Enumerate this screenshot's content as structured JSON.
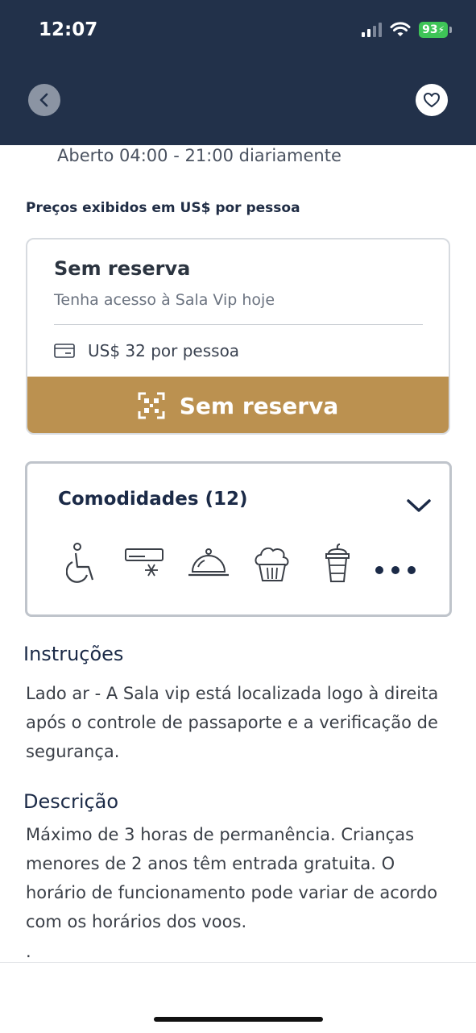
{
  "status_bar": {
    "time": "12:07",
    "battery": "93"
  },
  "header": {
    "back_icon": "chevron-left-icon",
    "favorite_icon": "heart-icon"
  },
  "hours": "Aberto 04:00 - 21:00 diariamente",
  "price_note": "Preços exibidos em US$ por pessoa",
  "booking": {
    "title": "Sem reserva",
    "subtitle": "Tenha acesso à Sala Vip hoje",
    "price": "US$ 32 por pessoa",
    "button_label": "Sem reserva",
    "accent_color": "#bb9150"
  },
  "amenities": {
    "title": "Comodidades (12)",
    "icons": [
      "wheelchair-icon",
      "air-conditioning-icon",
      "food-service-icon",
      "bakery-icon",
      "drink-icon",
      "more-icon"
    ]
  },
  "instructions": {
    "title": "Instruções",
    "body": "Lado ar - A Sala vip está localizada logo à direita após o controle de passaporte e a verificação de segurança."
  },
  "description": {
    "title": "Descrição",
    "body": "Máximo de 3 horas de permanência. Crianças menores de 2 anos têm entrada gratuita. O horário de funcionamento pode variar de acordo com os horários dos voos.",
    "trailing": "."
  },
  "colors": {
    "header_bg": "#22314a",
    "navy_text": "#1b2a47"
  }
}
